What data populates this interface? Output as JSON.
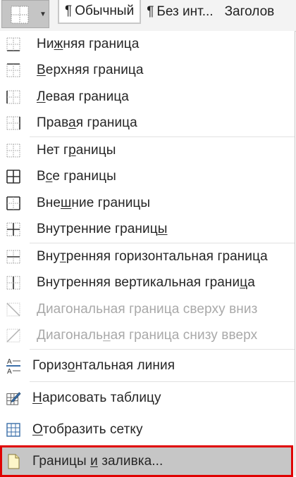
{
  "ribbon": {
    "styles": [
      {
        "mark": "¶",
        "label": "Обычный",
        "selected": true
      },
      {
        "mark": "¶",
        "label": "Без инт...",
        "selected": false
      },
      {
        "mark": "",
        "label": "Заголов",
        "selected": false
      }
    ]
  },
  "menu": {
    "groups": [
      [
        {
          "label": "Нижняя граница",
          "u": 2,
          "icon": "border-bottom-icon",
          "disabled": false
        },
        {
          "label": "Верхняя граница",
          "u": 0,
          "icon": "border-top-icon",
          "disabled": false
        },
        {
          "label": "Левая граница",
          "u": 0,
          "icon": "border-left-icon",
          "disabled": false
        },
        {
          "label": "Правая граница",
          "u": 4,
          "icon": "border-right-icon",
          "disabled": false
        }
      ],
      [
        {
          "label": "Нет границы",
          "u": 5,
          "icon": "no-border-icon",
          "disabled": false
        },
        {
          "label": "Все границы",
          "u": 1,
          "icon": "all-borders-icon",
          "disabled": false
        },
        {
          "label": "Внешние границы",
          "u": 3,
          "icon": "outside-borders-icon",
          "disabled": false
        },
        {
          "label": "Внутренние границы",
          "u": 17,
          "icon": "inside-borders-icon",
          "disabled": false
        }
      ],
      [
        {
          "label": "Внутренняя горизонтальная граница",
          "u": 3,
          "icon": "inside-horizontal-border-icon",
          "disabled": false
        },
        {
          "label": "Внутренняя вертикальная граница",
          "u": 29,
          "icon": "inside-vertical-border-icon",
          "disabled": false
        },
        {
          "label": "Диагональная граница сверху вниз",
          "u": -1,
          "icon": "diagonal-down-border-icon",
          "disabled": true
        },
        {
          "label": "Диагональная граница снизу вверх",
          "u": 9,
          "icon": "diagonal-up-border-icon",
          "disabled": true
        }
      ],
      [
        {
          "label": "Горизонтальная линия",
          "u": 5,
          "icon": "horizontal-line-icon",
          "disabled": false,
          "tall": true
        }
      ],
      [
        {
          "label": "Нарисовать таблицу",
          "u": 0,
          "icon": "draw-table-icon",
          "disabled": false,
          "tall": true
        },
        {
          "label": "Отобразить сетку",
          "u": 0,
          "icon": "view-gridlines-icon",
          "disabled": false,
          "tall": true
        },
        {
          "label": "Границы и заливка...",
          "u": 8,
          "icon": "borders-and-shading-icon",
          "disabled": false,
          "tall": true,
          "highlight": true
        }
      ]
    ]
  },
  "colors": {
    "highlight_outline": "#e00000",
    "highlight_fill": "#c6c6c6",
    "icon_blue": "#3a6ea8"
  }
}
